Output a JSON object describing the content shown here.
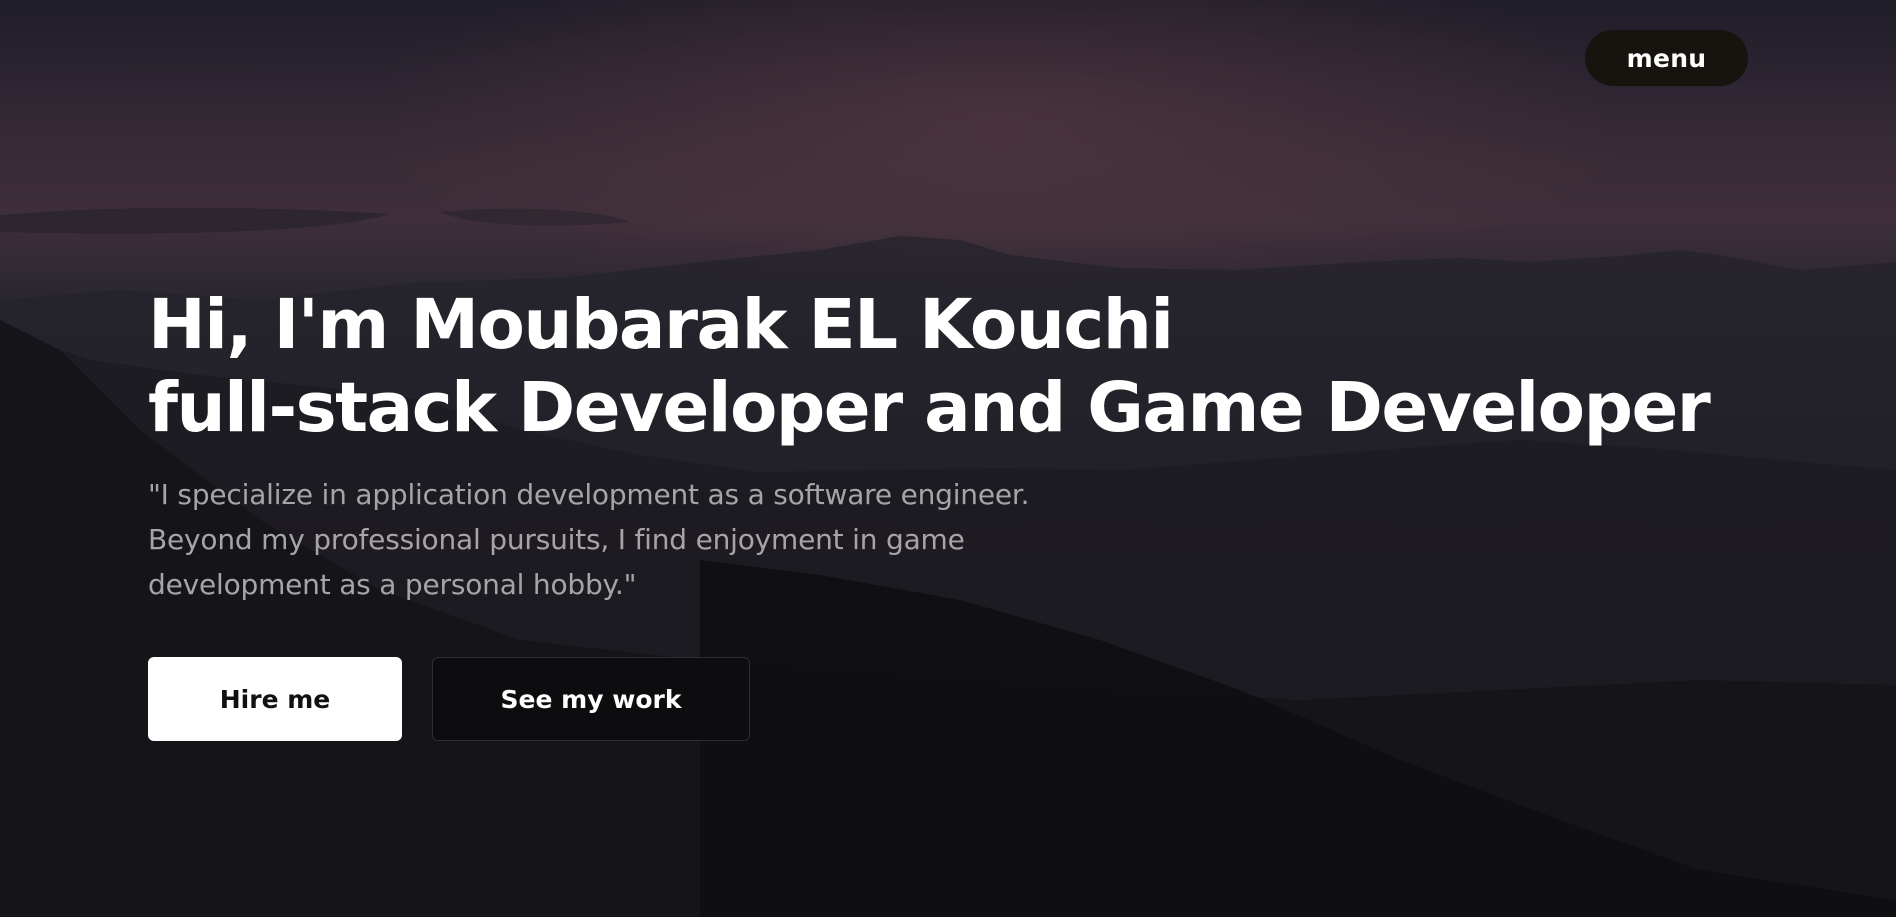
{
  "header": {
    "menu_label": "menu"
  },
  "hero": {
    "headline_line1": "Hi, I'm Moubarak EL Kouchi",
    "headline_line2": "full-stack Developer and Game Developer",
    "tagline": "\"I specialize in application development as a software engineer. Beyond my professional pursuits, I find enjoyment in game development as a personal hobby.\"",
    "primary_cta": "Hire me",
    "secondary_cta": "See my work"
  },
  "colors": {
    "background": "#121116",
    "sky_accent": "#3e2f3a",
    "primary_button_bg": "#ffffff",
    "secondary_button_bg": "#0d0c0f",
    "menu_button_bg": "#17130f",
    "tagline_text": "#a7a4a8"
  }
}
